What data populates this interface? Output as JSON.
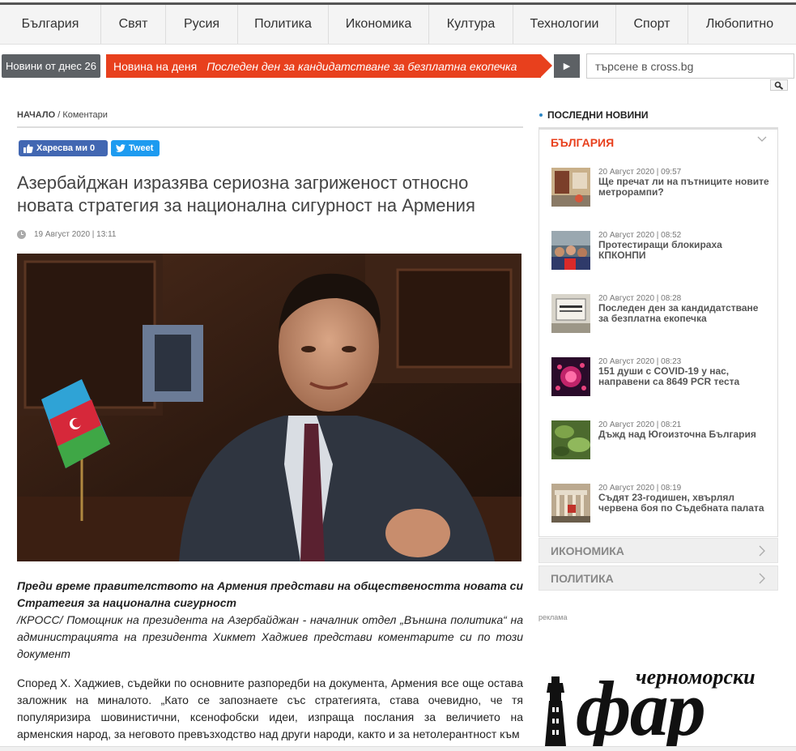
{
  "nav": {
    "items": [
      {
        "label": "България",
        "width": 125
      },
      {
        "label": "Свят",
        "width": 80
      },
      {
        "label": "Русия",
        "width": 89
      },
      {
        "label": "Политика",
        "width": 112
      },
      {
        "label": "Икономика",
        "width": 124
      },
      {
        "label": "Култура",
        "width": 104
      },
      {
        "label": "Технологии",
        "width": 127
      },
      {
        "label": "Спорт",
        "width": 89
      },
      {
        "label": "Любопитно",
        "width": 127
      }
    ]
  },
  "ticker": {
    "today_label": "Новини от днес 26",
    "news_day_label": "Новина на деня",
    "news_day_text": "Последен ден за кандидатстване за безплатна екопечка",
    "play_icon": "play-icon",
    "search_placeholder": "търсене в cross.bg"
  },
  "breadcrumb": {
    "home": "НАЧАЛО",
    "sep": "/",
    "current": "Коментари"
  },
  "social": {
    "like_label": "Харесва ми 0",
    "tweet_label": "Tweet"
  },
  "article": {
    "title": "Азербайджан изразява сериозна загриженост относно новата стратегия за национална сигурност на Армения",
    "date": "19 Август 2020 | 13:11",
    "lead_bold": "Преди време правителството на Армения представи на обществеността новата си Стратегия за национална сигурност",
    "lead_text": "/КРОСС/ Помощник на президента на Азербайджан - началник отдел „Външна политика“ на администрацията на президента Хикмет Хаджиев представи коментарите си по този документ",
    "body": "Според Х. Хаджиев, съдейки по основните разпоредби на документа, Армения все още остава заложник на миналото. „Като се запознаете със стратегията, става очевидно, че тя популяризира шовинистични, ксенофобски идеи, изпраща послания за величието на арменския народ, за неговото превъзходство над други народи, както и за нетолерантност към"
  },
  "sidebar": {
    "heading": "ПОСЛЕДНИ НОВИНИ",
    "active_category": "БЪЛГАРИЯ",
    "news": [
      {
        "date": "20 Август 2020 | 09:57",
        "title": "Ще пречат ли на пътниците новите метрорампи?",
        "thumb": "metro"
      },
      {
        "date": "20 Август 2020 | 08:52",
        "title": "Протестиращи блокираха КПКОНПИ",
        "thumb": "protest"
      },
      {
        "date": "20 Август 2020 | 08:28",
        "title": "Последен ден за кандидатстване за безплатна екопечка",
        "thumb": "sign"
      },
      {
        "date": "20 Август 2020 | 08:23",
        "title": "151 души с COVID-19 у нас, направени са 8649 PCR теста",
        "thumb": "virus"
      },
      {
        "date": "20 Август 2020 | 08:21",
        "title": "Дъжд над Югоизточна България",
        "thumb": "rain"
      },
      {
        "date": "20 Август 2020 | 08:19",
        "title": "Съдят 23-годишен, хвърлял червена боя по Съдебната палата",
        "thumb": "court"
      }
    ],
    "collapsed_categories": [
      "ИКОНОМИКА",
      "ПОЛИТИКА"
    ],
    "ad_label": "реклама",
    "ad_logo_top": "черноморски",
    "ad_logo_main": "фар"
  },
  "colors": {
    "accent": "#e8401d",
    "dark": "#5d6165",
    "facebook": "#4267b2",
    "twitter": "#1d9bf0"
  }
}
